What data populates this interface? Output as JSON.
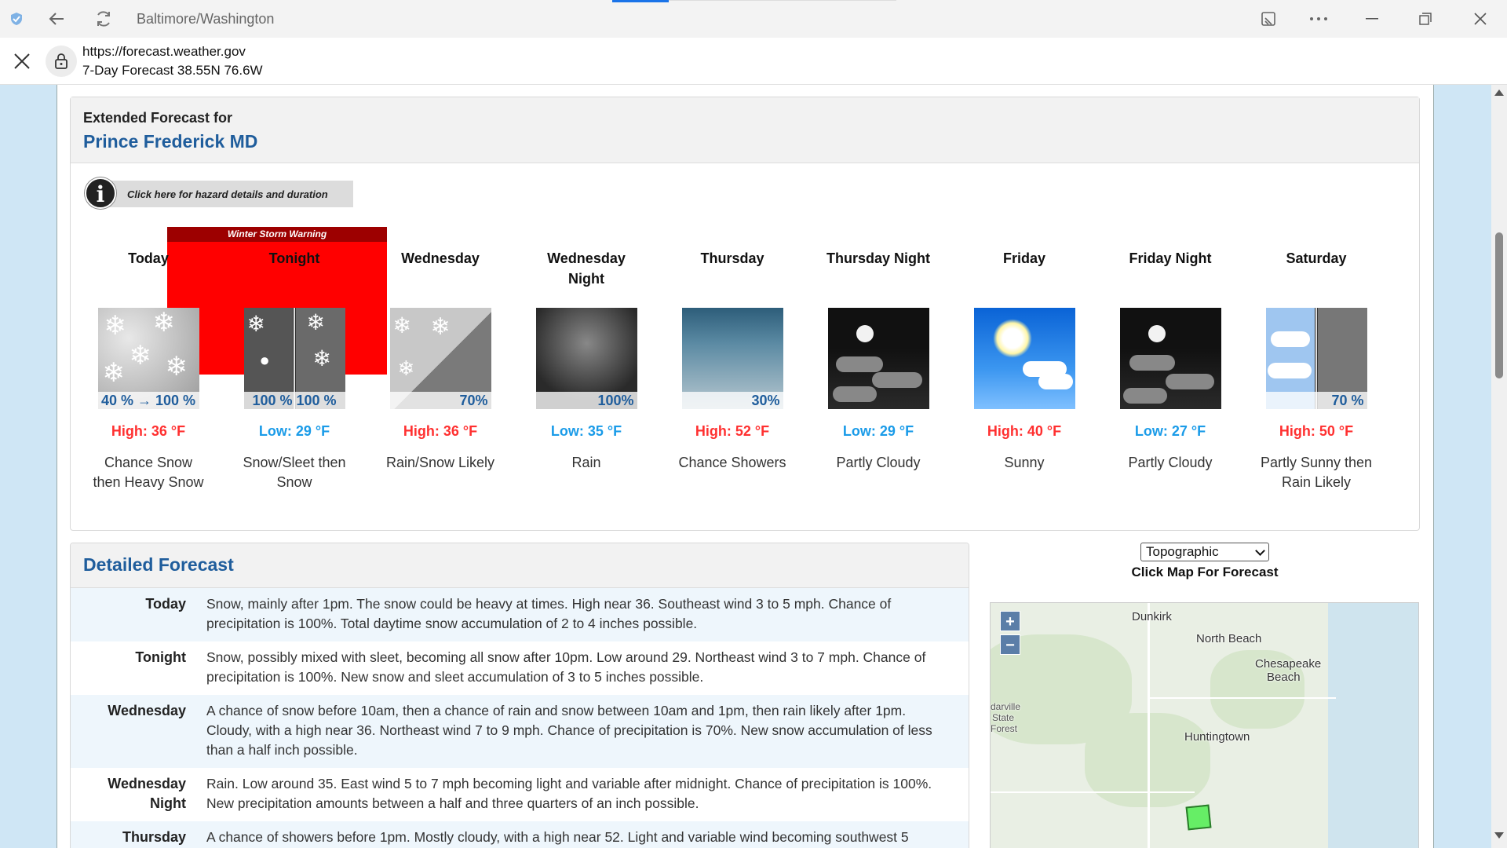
{
  "browser": {
    "title": "Baltimore/Washington",
    "url": "https://forecast.weather.gov",
    "page_subtitle": "7-Day Forecast 38.55N 76.6W"
  },
  "extended": {
    "label": "Extended Forecast for",
    "city": "Prince Frederick MD",
    "hazard_button": "Click here for hazard details and duration",
    "warning_label": "Winter Storm Warning",
    "periods": [
      {
        "name": "Today",
        "pop": "40 % → 100 %",
        "temp": "High: 36 °F",
        "desc": "Chance Snow then Heavy Snow",
        "icon": "snow-icon"
      },
      {
        "name": "Tonight",
        "pop": "100 % 100 %",
        "temp": "Low: 29 °F",
        "desc": "Snow/Sleet then Snow",
        "icon": "sleet-snow-icon"
      },
      {
        "name": "Wednesday",
        "pop": "70%",
        "temp": "High: 36 °F",
        "desc": "Rain/Snow Likely",
        "icon": "rain-snow-icon"
      },
      {
        "name": "Wednesday Night",
        "pop": "100%",
        "temp": "Low: 35 °F",
        "desc": "Rain",
        "icon": "rain-icon"
      },
      {
        "name": "Thursday",
        "pop": "30%",
        "temp": "High: 52 °F",
        "desc": "Chance Showers",
        "icon": "showers-icon"
      },
      {
        "name": "Thursday Night",
        "pop": "",
        "temp": "Low: 29 °F",
        "desc": "Partly Cloudy",
        "icon": "partly-cloudy-night-icon"
      },
      {
        "name": "Friday",
        "pop": "",
        "temp": "High: 40 °F",
        "desc": "Sunny",
        "icon": "sunny-icon"
      },
      {
        "name": "Friday Night",
        "pop": "",
        "temp": "Low: 27 °F",
        "desc": "Partly Cloudy",
        "icon": "partly-cloudy-night-icon"
      },
      {
        "name": "Saturday",
        "pop": "70 %",
        "temp": "High: 50 °F",
        "desc": "Partly Sunny then Rain Likely",
        "icon": "partly-sunny-rain-icon"
      }
    ]
  },
  "detailed": {
    "title": "Detailed Forecast",
    "rows": [
      {
        "label": "Today",
        "text": "Snow, mainly after 1pm. The snow could be heavy at times. High near 36. Southeast wind 3 to 5 mph. Chance of precipitation is 100%. Total daytime snow accumulation of 2 to 4 inches possible."
      },
      {
        "label": "Tonight",
        "text": "Snow, possibly mixed with sleet, becoming all snow after 10pm. Low around 29. Northeast wind 3 to 7 mph. Chance of precipitation is 100%. New snow and sleet accumulation of 3 to 5 inches possible."
      },
      {
        "label": "Wednesday",
        "text": "A chance of snow before 10am, then a chance of rain and snow between 10am and 1pm, then rain likely after 1pm. Cloudy, with a high near 36. Northeast wind 7 to 9 mph. Chance of precipitation is 70%. New snow accumulation of less than a half inch possible."
      },
      {
        "label": "Wednesday Night",
        "text": "Rain. Low around 35. East wind 5 to 7 mph becoming light and variable after midnight. Chance of precipitation is 100%. New precipitation amounts between a half and three quarters of an inch possible."
      },
      {
        "label": "Thursday",
        "text": "A chance of showers before 1pm. Mostly cloudy, with a high near 52. Light and variable wind becoming southwest 5"
      }
    ]
  },
  "map": {
    "select_value": "Topographic",
    "caption": "Click Map For Forecast",
    "zoom_in": "+",
    "zoom_out": "−",
    "labels": {
      "dunkirk": "Dunkirk",
      "north_beach": "North Beach",
      "chesapeake_1": "Chesapeake",
      "chesapeake_2": "Beach",
      "cedarville_1": "darville",
      "cedarville_2": "State",
      "cedarville_3": "Forest",
      "huntingtown": "Huntingtown"
    }
  },
  "colors": {
    "title_blue": "#1f5d9c",
    "high_red": "#ff3030",
    "low_blue": "#1a9be8",
    "warning_red": "#ff0000"
  }
}
